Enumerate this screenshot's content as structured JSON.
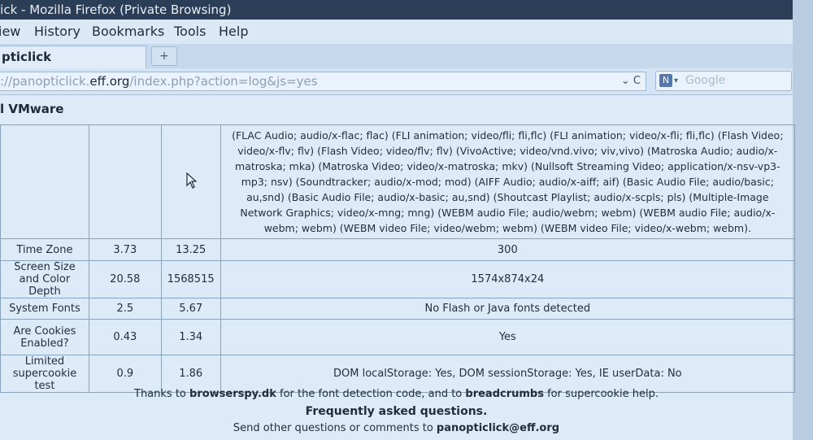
{
  "window": {
    "title": "lick - Mozilla Firefox (Private Browsing)"
  },
  "menu": {
    "items": [
      "iew",
      "History",
      "Bookmarks",
      "Tools",
      "Help"
    ]
  },
  "tabs": {
    "active_label": "pticlick",
    "new_tab_symbol": "+"
  },
  "navigation": {
    "url_prefix": "://panopticlick.",
    "url_host": "eff.org",
    "url_path": "/index.php?action=log&js=yes",
    "url_controls": "⌄ C",
    "search_placeholder": "Google",
    "search_engine_icon": "N"
  },
  "page": {
    "heading": "l VMware",
    "mime_text": "(FLAC Audio; audio/x-flac; flac) (FLI animation; video/fli; fli,flc) (FLI animation; video/x-fli; fli,flc) (Flash Video; video/x-flv; flv) (Flash Video; video/flv; flv) (VivoActive; video/vnd.vivo; viv,vivo) (Matroska Audio; audio/x-matroska; mka) (Matroska Video; video/x-matroska; mkv) (Nullsoft Streaming Video; application/x-nsv-vp3-mp3; nsv) (Soundtracker; audio/x-mod; mod) (AIFF Audio; audio/x-aiff; aif) (Basic Audio File; audio/basic; au,snd) (Basic Audio File; audio/x-basic; au,snd) (Shoutcast Playlist; audio/x-scpls; pls) (Multiple-Image Network Graphics; video/x-mng; mng) (WEBM audio File; audio/webm; webm) (WEBM audio File; audio/x-webm; webm) (WEBM video File; video/webm; webm) (WEBM video File; video/x-webm; webm).",
    "rows": [
      {
        "label": "Time Zone",
        "bits": "3.73",
        "one_in": "13.25",
        "value": "300"
      },
      {
        "label": "Screen Size and Color Depth",
        "bits": "20.58",
        "one_in": "1568515",
        "value": "1574x874x24"
      },
      {
        "label": "System Fonts",
        "bits": "2.5",
        "one_in": "5.67",
        "value": "No Flash or Java fonts detected"
      },
      {
        "label": "Are Cookies Enabled?",
        "bits": "0.43",
        "one_in": "1.34",
        "value": "Yes"
      },
      {
        "label": "Limited supercookie test",
        "bits": "0.9",
        "one_in": "1.86",
        "value": "DOM localStorage: Yes, DOM sessionStorage: Yes, IE userData: No"
      }
    ],
    "footer": {
      "thanks_pre": "Thanks to ",
      "thanks_link1": "browserspy.dk",
      "thanks_mid": " for the font detection code, and to ",
      "thanks_link2": "breadcrumbs",
      "thanks_post": " for supercookie help.",
      "faq": "Frequently asked questions.",
      "contact_pre": "Send other questions or comments to ",
      "contact_email": "panopticlick@eff.org"
    }
  }
}
